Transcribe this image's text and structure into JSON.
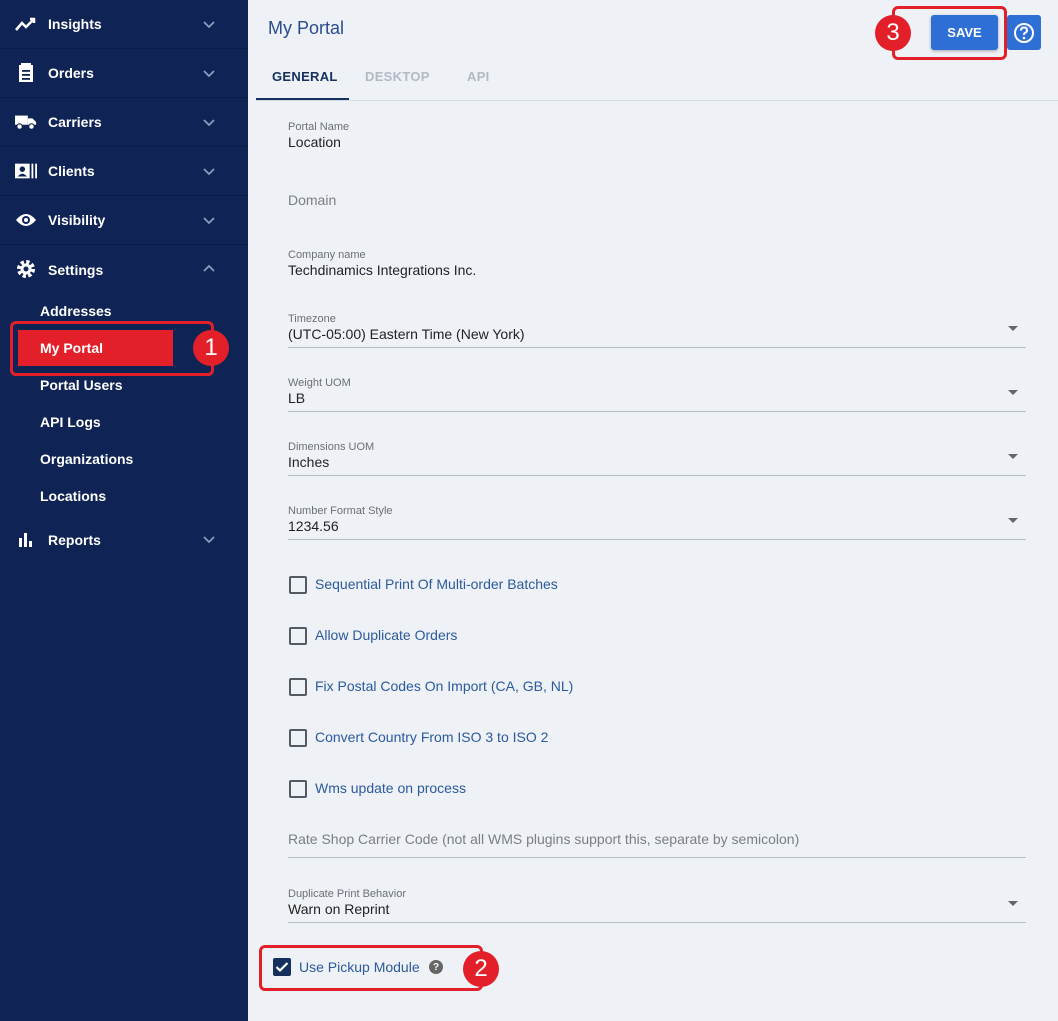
{
  "sidebar": {
    "items": [
      {
        "label": "Insights",
        "icon": "trending-up-icon"
      },
      {
        "label": "Orders",
        "icon": "clipboard-icon"
      },
      {
        "label": "Carriers",
        "icon": "truck-icon"
      },
      {
        "label": "Clients",
        "icon": "contact-card-icon"
      },
      {
        "label": "Visibility",
        "icon": "eye-icon"
      },
      {
        "label": "Settings",
        "icon": "gear-icon"
      },
      {
        "label": "Reports",
        "icon": "bar-chart-icon"
      }
    ],
    "settings_sub": [
      "Addresses",
      "My Portal",
      "Portal Users",
      "API Logs",
      "Organizations",
      "Locations"
    ],
    "active_sub": "My Portal"
  },
  "header": {
    "title": "My Portal",
    "save_label": "SAVE",
    "help_icon": "help-circle-icon"
  },
  "tabs": [
    {
      "label": "GENERAL",
      "active": true
    },
    {
      "label": "DESKTOP",
      "active": false
    },
    {
      "label": "API",
      "active": false
    }
  ],
  "form": {
    "portal_name": {
      "caption": "Portal Name",
      "value": "Location"
    },
    "domain": {
      "placeholder": "Domain"
    },
    "company_name": {
      "caption": "Company name",
      "value": "Techdinamics Integrations Inc."
    },
    "timezone": {
      "caption": "Timezone",
      "value": "(UTC-05:00) Eastern Time (New York)"
    },
    "weight_uom": {
      "caption": "Weight UOM",
      "value": "LB"
    },
    "dimensions_uom": {
      "caption": "Dimensions UOM",
      "value": "Inches"
    },
    "number_format": {
      "caption": "Number Format Style",
      "value": "1234.56"
    },
    "checkboxes": [
      {
        "label": "Sequential Print Of Multi-order Batches",
        "checked": false
      },
      {
        "label": "Allow Duplicate Orders",
        "checked": false
      },
      {
        "label": "Fix Postal Codes On Import (CA, GB, NL)",
        "checked": false
      },
      {
        "label": "Convert Country From ISO 3 to ISO 2",
        "checked": false
      },
      {
        "label": "Wms update on process",
        "checked": false
      }
    ],
    "rate_shop": {
      "placeholder": "Rate Shop Carrier Code (not all WMS plugins support this, separate by semicolon)"
    },
    "duplicate_print": {
      "caption": "Duplicate Print Behavior",
      "value": "Warn on Reprint"
    },
    "pickup_module": {
      "label": "Use Pickup Module",
      "checked": true
    }
  },
  "annotations": [
    "1",
    "2",
    "3"
  ],
  "colors": {
    "sidebar_bg": "#0f2454",
    "accent_red": "#e3202a",
    "primary_blue": "#2e6fd6"
  }
}
